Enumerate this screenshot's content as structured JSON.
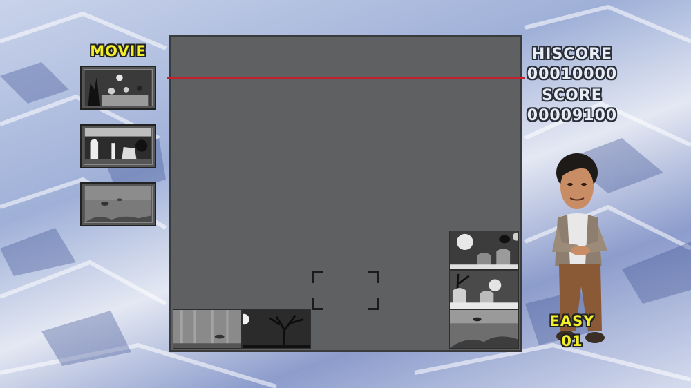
{
  "movie_panel": {
    "title": "MOVIE",
    "thumbnails": [
      "halloween-night-scene",
      "ghost-candle-scene",
      "underwater-fish-scene"
    ]
  },
  "score_panel": {
    "hiscore_label": "HISCORE",
    "hiscore_value": "00010000",
    "score_label": "SCORE",
    "score_value": "00009100"
  },
  "difficulty": {
    "label": "EASY",
    "level": "01"
  },
  "colors": {
    "board": "#5f6062",
    "limit_line": "#c3212e",
    "hud_yellow": "#f2ee2a",
    "hud_silver": "#e8ecf4"
  },
  "board_blocks": [
    {
      "scene": "underwater-fish",
      "column": 1,
      "row_from_bottom": 1
    },
    {
      "scene": "moon-dead-tree",
      "column": 2,
      "row_from_bottom": 1
    },
    {
      "scene": "underwater-fish",
      "column": 5,
      "row_from_bottom": 1
    },
    {
      "scene": "graveyard-ghost",
      "column": 5,
      "row_from_bottom": 2
    },
    {
      "scene": "halloween-ghost-spider",
      "column": 5,
      "row_from_bottom": 3
    }
  ],
  "avatar": "player-avatar"
}
